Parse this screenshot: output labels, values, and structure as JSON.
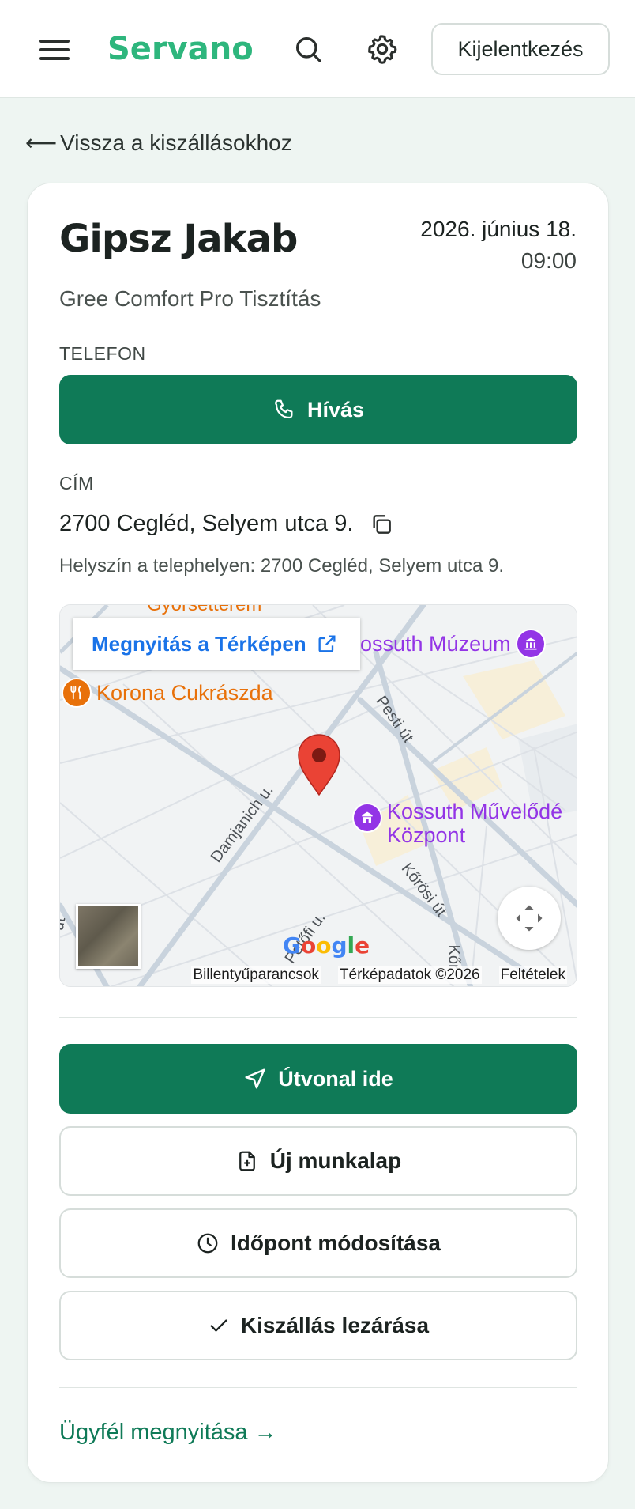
{
  "header": {
    "brand": "Servano",
    "logout_label": "Kijelentkezés"
  },
  "back_link": "Vissza a kiszállásokhoz",
  "job": {
    "client_name": "Gipsz Jakab",
    "date": "2026. június 18.",
    "time": "09:00",
    "service": "Gree Comfort Pro Tisztítás",
    "phone_label": "TELEFON",
    "call_label": "Hívás",
    "address_label": "CÍM",
    "address": "2700 Cegléd, Selyem utca 9.",
    "location_note": "Helyszín a telephelyen: 2700 Cegléd, Selyem utca 9."
  },
  "map": {
    "open_label": "Megnyitás a Térképen",
    "pois": {
      "partial_top": "Gyorsétterem",
      "museum": "Kossuth Múzeum",
      "cafe": "Korona Cukrászda",
      "culture_line1": "Kossuth Művelődé",
      "culture_line2": "Központ"
    },
    "streets": {
      "pesti": "Pesti út",
      "damjanich": "Damjanich u.",
      "korosi": "Kőrösi út",
      "petofi": "Petőfi u.",
      "kor": "Kőr",
      "ut": "út"
    },
    "google": "Google",
    "footer": {
      "shortcuts": "Billentyűparancsok",
      "data": "Térképadatok ©2026",
      "terms": "Feltételek"
    }
  },
  "actions": {
    "route": "Útvonal ide",
    "new_worksheet": "Új munkalap",
    "reschedule": "Időpont módosítása",
    "close_visit": "Kiszállás lezárása"
  },
  "customer_link": "Ügyfél megnyitása →",
  "colors": {
    "primary": "#0f7a57",
    "brand": "#2eb67d",
    "map_link": "#1a73e8",
    "poi_food": "#e8710a",
    "poi_culture": "#9334e6"
  }
}
